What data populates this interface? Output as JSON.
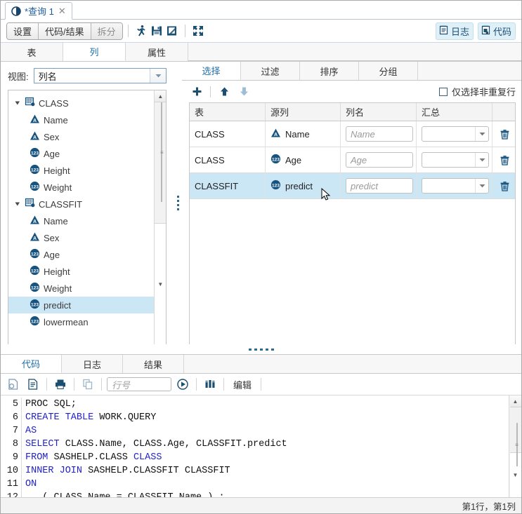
{
  "window": {
    "doc_tab": {
      "label": "*查询 1",
      "close": "✕",
      "icon": "query-icon"
    }
  },
  "toolbar": {
    "segments": [
      {
        "label": "设置",
        "state": "active"
      },
      {
        "label": "代码/结果",
        "state": "active"
      },
      {
        "label": "拆分",
        "state": "inactive"
      }
    ],
    "icons": [
      {
        "name": "run-icon",
        "title": "运行"
      },
      {
        "name": "save-icon",
        "title": "保存"
      },
      {
        "name": "save-as-icon",
        "title": "另存为"
      },
      {
        "name": "maximize-icon",
        "title": "最大化"
      }
    ],
    "right_buttons": [
      {
        "label": "日志",
        "icon": "log-icon"
      },
      {
        "label": "代码",
        "icon": "code-icon"
      }
    ]
  },
  "upper_tabs": [
    {
      "label": "表",
      "active": false
    },
    {
      "label": "列",
      "active": true
    },
    {
      "label": "属性",
      "active": false
    }
  ],
  "left_panel": {
    "view_label": "视图:",
    "view_value": "列名",
    "tree": [
      {
        "label": "CLASS",
        "type": "table",
        "level": 0,
        "expanded": true,
        "selected": false
      },
      {
        "label": "Name",
        "type": "char",
        "level": 1,
        "selected": false
      },
      {
        "label": "Sex",
        "type": "char",
        "level": 1,
        "selected": false
      },
      {
        "label": "Age",
        "type": "num",
        "level": 1,
        "selected": false
      },
      {
        "label": "Height",
        "type": "num",
        "level": 1,
        "selected": false
      },
      {
        "label": "Weight",
        "type": "num",
        "level": 1,
        "selected": false
      },
      {
        "label": "CLASSFIT",
        "type": "table",
        "level": 0,
        "expanded": true,
        "selected": false
      },
      {
        "label": "Name",
        "type": "char",
        "level": 1,
        "selected": false
      },
      {
        "label": "Sex",
        "type": "char",
        "level": 1,
        "selected": false
      },
      {
        "label": "Age",
        "type": "num",
        "level": 1,
        "selected": false
      },
      {
        "label": "Height",
        "type": "num",
        "level": 1,
        "selected": false
      },
      {
        "label": "Weight",
        "type": "num",
        "level": 1,
        "selected": false
      },
      {
        "label": "predict",
        "type": "num",
        "level": 1,
        "selected": true
      },
      {
        "label": "lowermean",
        "type": "num",
        "level": 1,
        "selected": false
      }
    ]
  },
  "right_panel": {
    "tabs": [
      {
        "label": "选择",
        "active": true
      },
      {
        "label": "过滤",
        "active": false
      },
      {
        "label": "排序",
        "active": false
      },
      {
        "label": "分组",
        "active": false
      }
    ],
    "toolbar": {
      "add_icon": "plus-icon",
      "move_up_icon": "arrow-up-icon",
      "move_down_icon": "arrow-down-icon",
      "checkbox_label": "仅选择非重复行",
      "checkbox_checked": false
    },
    "grid": {
      "headers": [
        "表",
        "源列",
        "列名",
        "汇总",
        ""
      ],
      "rows": [
        {
          "table": "CLASS",
          "source_column": "Name",
          "source_type": "char",
          "alias_placeholder": "Name",
          "alias_value": "",
          "summary_value": "",
          "selected": false,
          "delete_icon": "trash-icon"
        },
        {
          "table": "CLASS",
          "source_column": "Age",
          "source_type": "num",
          "alias_placeholder": "Age",
          "alias_value": "",
          "summary_value": "",
          "selected": false,
          "delete_icon": "trash-icon"
        },
        {
          "table": "CLASSFIT",
          "source_column": "predict",
          "source_type": "num",
          "alias_placeholder": "predict",
          "alias_value": "",
          "summary_value": "",
          "selected": true,
          "delete_icon": "trash-icon"
        }
      ]
    }
  },
  "bottom_panel": {
    "tabs": [
      {
        "label": "代码",
        "active": true
      },
      {
        "label": "日志",
        "active": false
      },
      {
        "label": "结果",
        "active": false
      }
    ],
    "toolbar": {
      "icons": [
        {
          "name": "code-preview-icon"
        },
        {
          "name": "code-format-icon"
        },
        {
          "name": "print-icon"
        },
        {
          "name": "copy-icon"
        },
        {
          "name": "run-code-icon"
        },
        {
          "name": "analyze-icon"
        }
      ],
      "line_placeholder": "行号",
      "line_value": "",
      "edit_label": "编辑"
    },
    "code": [
      {
        "num": "5",
        "tokens": [
          {
            "t": "PROC SQL;",
            "k": false
          }
        ]
      },
      {
        "num": "6",
        "tokens": [
          {
            "t": "CREATE TABLE",
            "k": true
          },
          {
            "t": " WORK.QUERY",
            "k": false
          }
        ]
      },
      {
        "num": "7",
        "tokens": [
          {
            "t": "AS",
            "k": true
          }
        ]
      },
      {
        "num": "8",
        "tokens": [
          {
            "t": "SELECT",
            "k": true
          },
          {
            "t": " CLASS.Name, CLASS.Age, CLASSFIT.predict",
            "k": false
          }
        ]
      },
      {
        "num": "9",
        "tokens": [
          {
            "t": "FROM",
            "k": true
          },
          {
            "t": " SASHELP.CLASS ",
            "k": false
          },
          {
            "t": "CLASS",
            "k": true
          }
        ]
      },
      {
        "num": "10",
        "tokens": [
          {
            "t": "INNER JOIN",
            "k": true
          },
          {
            "t": " SASHELP.CLASSFIT CLASSFIT",
            "k": false
          }
        ]
      },
      {
        "num": "11",
        "tokens": [
          {
            "t": "ON",
            "k": true
          }
        ]
      },
      {
        "num": "12",
        "tokens": [
          {
            "t": "   ( CLASS.Name = CLASSFIT.Name ) ;",
            "k": false
          }
        ]
      }
    ],
    "status": "第1行，第1列"
  },
  "colors": {
    "accent": "#1f5c99",
    "selection": "#cbe6f5",
    "icon_blue": "#1b4f72",
    "keyword": "#2222cc"
  }
}
